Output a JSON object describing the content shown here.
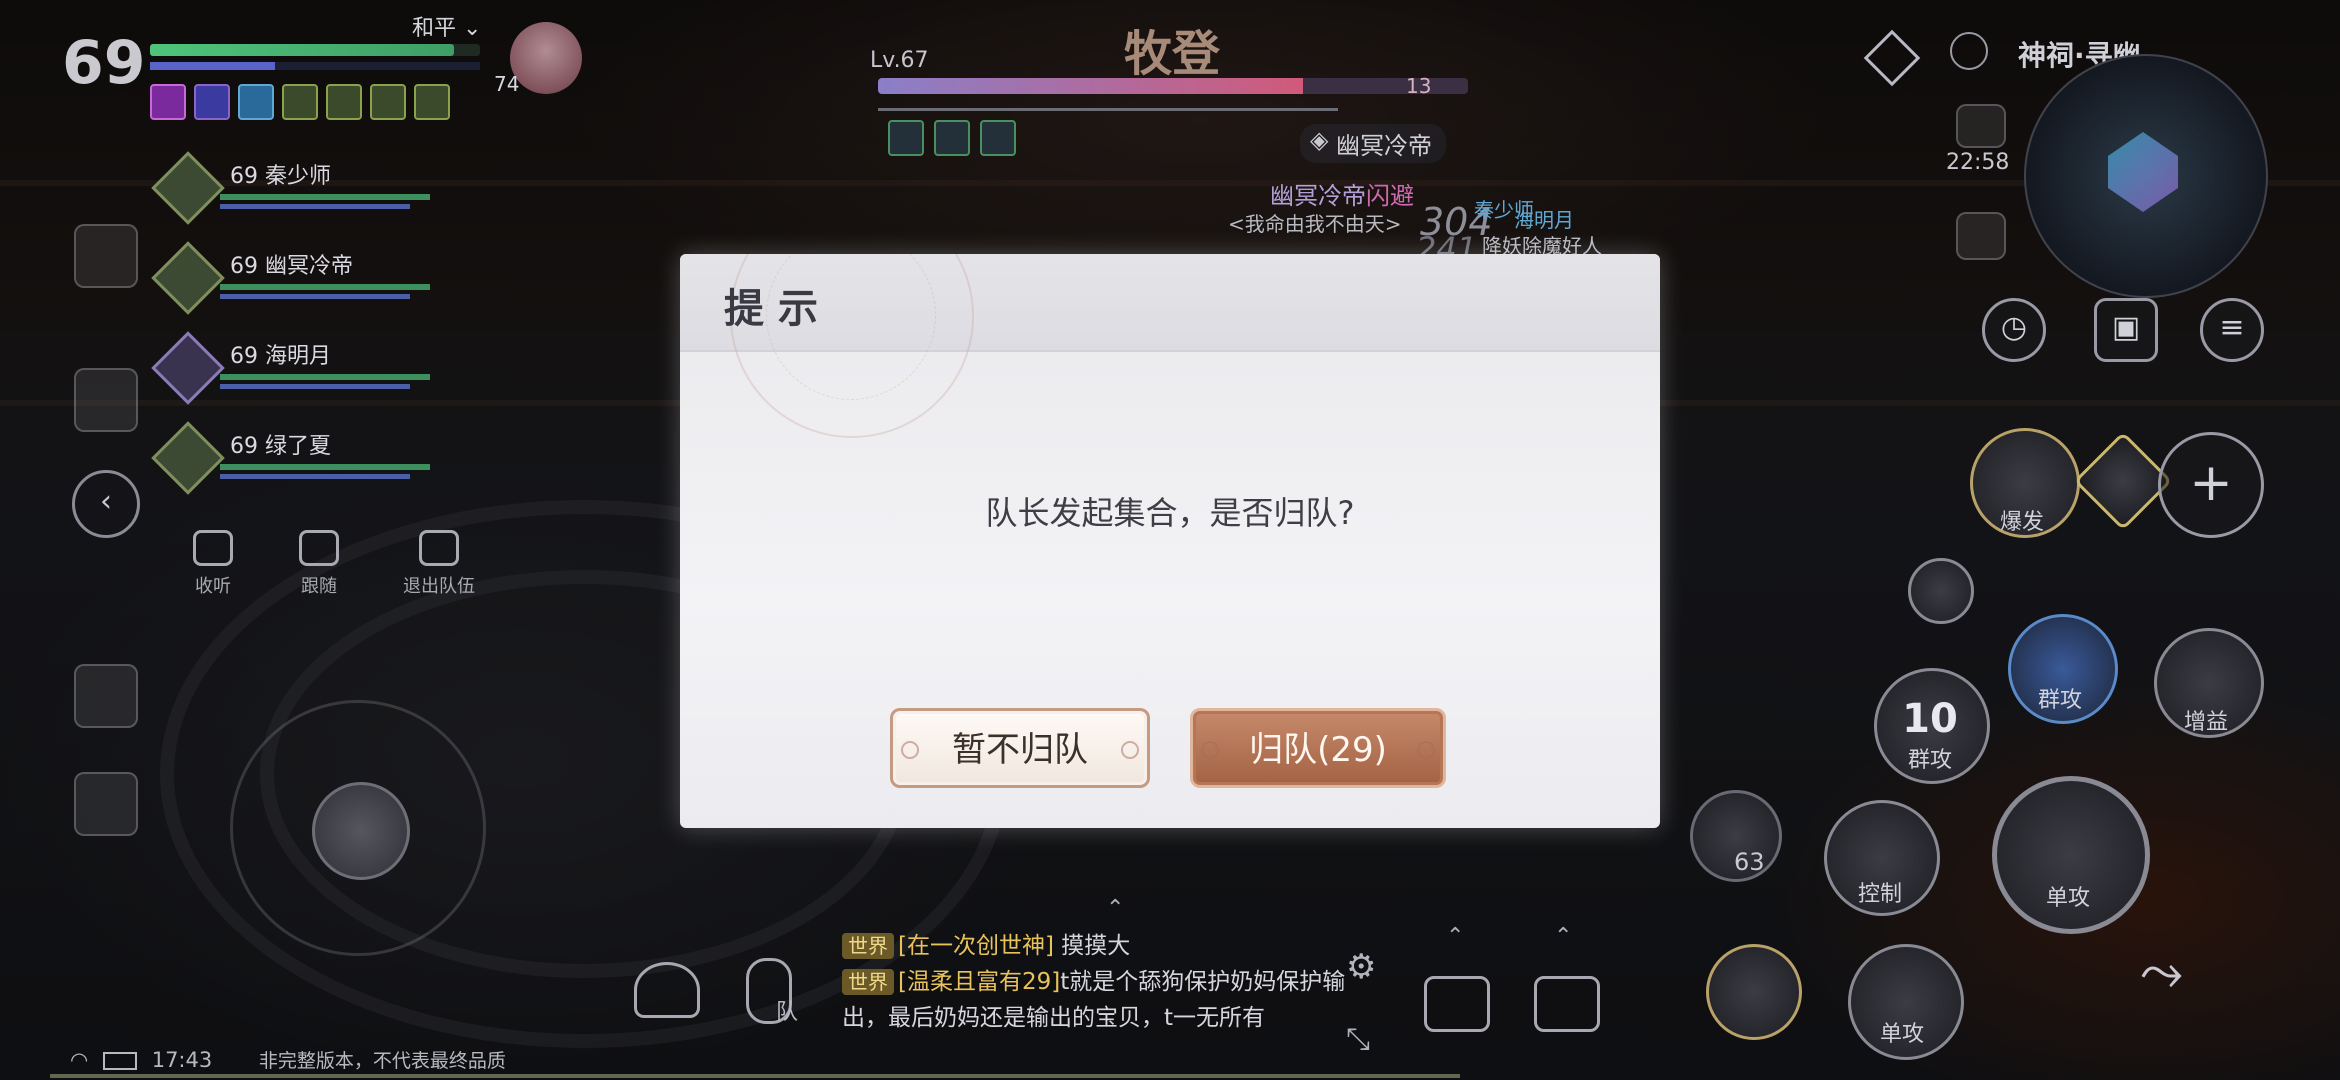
{
  "player": {
    "level": "69",
    "pvp_mode": "和平",
    "pet_level": "74"
  },
  "team": {
    "members": [
      {
        "level": "69",
        "name": "秦少师"
      },
      {
        "level": "69",
        "name": "幽冥冷帝"
      },
      {
        "level": "69",
        "name": "海明月"
      },
      {
        "level": "69",
        "name": "绿了夏"
      }
    ],
    "controls": {
      "listen": "收听",
      "follow": "跟随",
      "leave": "退出队伍"
    }
  },
  "boss": {
    "name": "牧登",
    "level": "Lv.67",
    "hp_bar_count": "13",
    "hp_fraction": 0.72,
    "target": "幽冥冷帝"
  },
  "overhead": {
    "guild_name": "幽冥冷帝",
    "guild_suffix": "闪避",
    "motto": "<我命由我不由天>",
    "damage_1": "304",
    "damage_2": "241",
    "other_name_1": "秦少师",
    "other_name_2": "海明月",
    "other_title": "降妖除魔好人"
  },
  "map": {
    "zone": "神祠·寻幽",
    "time": "22:58"
  },
  "skills": {
    "burst": "爆发",
    "group_attack": "群攻",
    "buff": "增益",
    "group_attack_2": "群攻",
    "group_attack_cd": "10",
    "control": "控制",
    "single_attack": "单攻",
    "single_attack_2": "单攻",
    "potion_count": "63",
    "add": "+"
  },
  "chat": {
    "messages": [
      {
        "channel": "世界",
        "sender": "[在一次创世神]",
        "text": "摸摸大"
      },
      {
        "channel": "世界",
        "sender": "[温柔且富有29]",
        "text": "t就是个舔狗保护奶妈保护输出，最后奶妈还是输出的宝贝，t一无所有"
      }
    ]
  },
  "voice_label": "队",
  "status_bar": {
    "time": "17:43",
    "notice": "非完整版本，不代表最终品质"
  },
  "dialog": {
    "title": "提示",
    "message": "队长发起集合，是否归队?",
    "cancel_label": "暂不归队",
    "confirm_label": "归队(29)"
  },
  "colors": {
    "confirm_button": "#a86848",
    "dialog_bg": "#ececf0",
    "hp_green": "#4fc47b"
  }
}
